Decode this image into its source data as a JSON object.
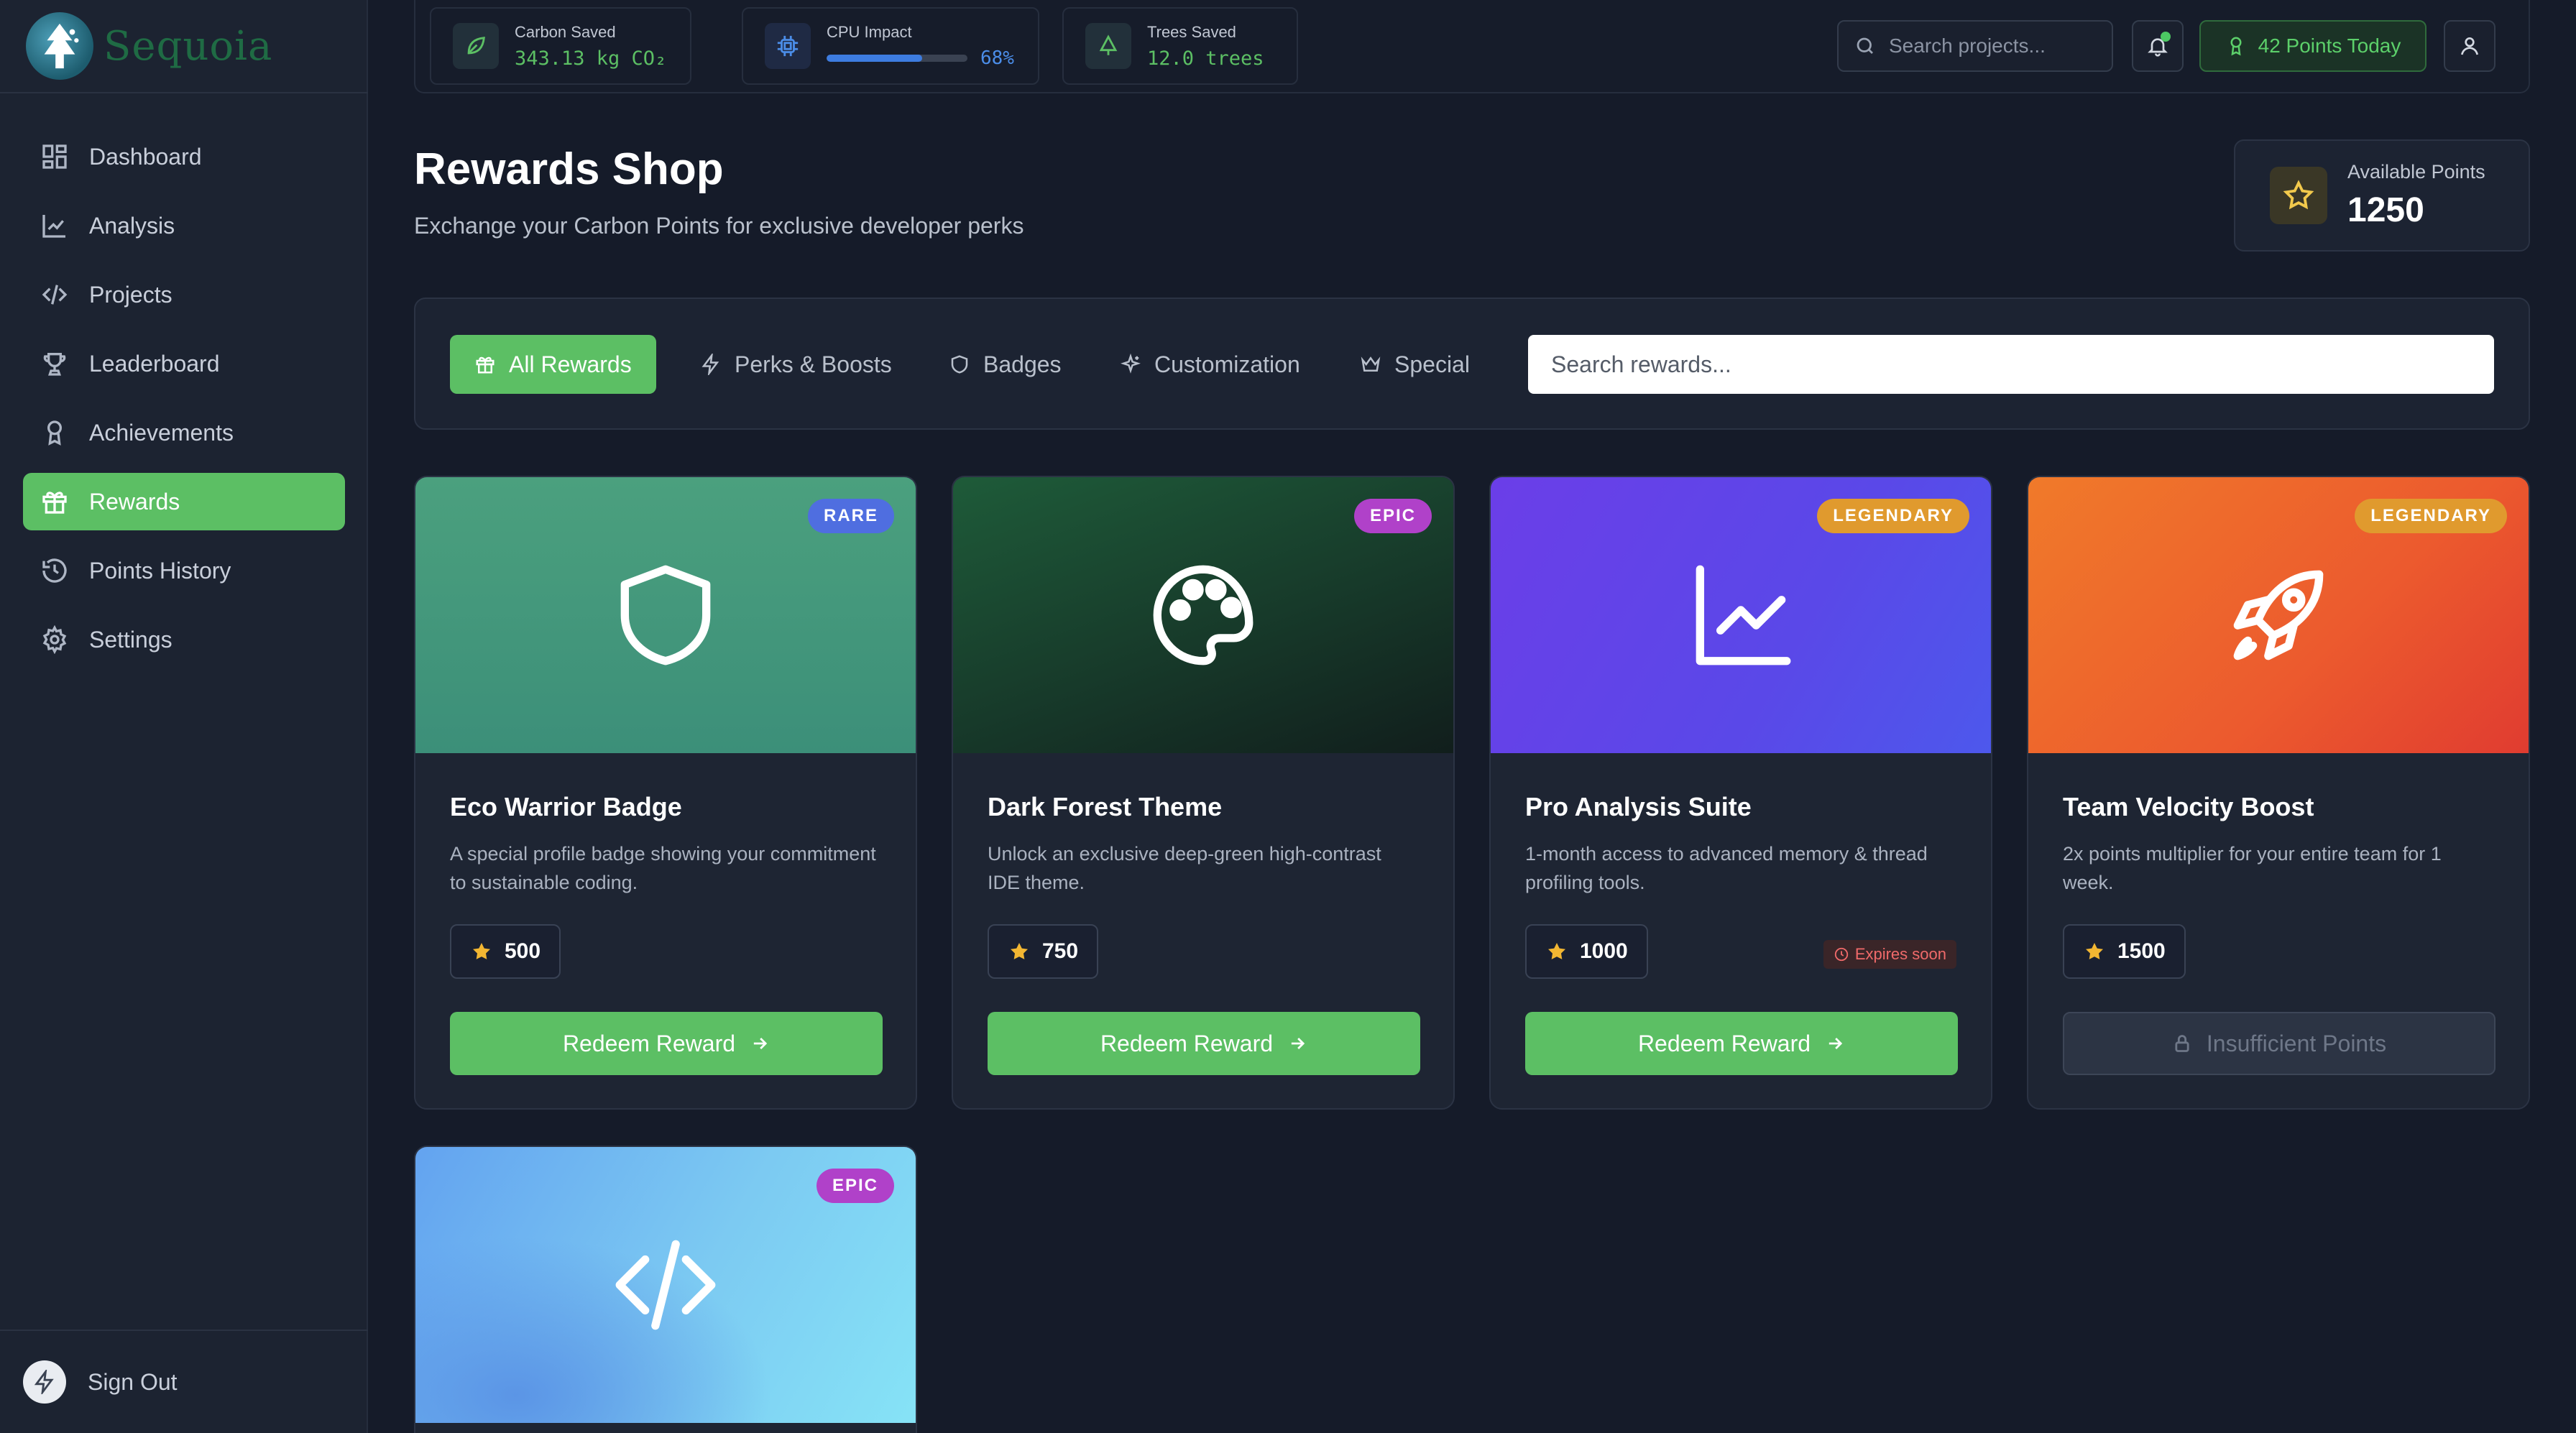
{
  "brand": {
    "name": "Sequoia"
  },
  "nav": {
    "items": [
      {
        "label": "Dashboard",
        "icon": "grid-icon"
      },
      {
        "label": "Analysis",
        "icon": "line-chart-icon"
      },
      {
        "label": "Projects",
        "icon": "code-icon"
      },
      {
        "label": "Leaderboard",
        "icon": "trophy-icon"
      },
      {
        "label": "Achievements",
        "icon": "award-icon"
      },
      {
        "label": "Rewards",
        "icon": "gift-icon",
        "active": true
      },
      {
        "label": "Points History",
        "icon": "history-icon"
      },
      {
        "label": "Settings",
        "icon": "gear-icon"
      }
    ],
    "sign_out": "Sign Out"
  },
  "topbar": {
    "carbon": {
      "label": "Carbon Saved",
      "value": "343.13 kg CO₂"
    },
    "cpu": {
      "label": "CPU Impact",
      "value": "68%",
      "percent": 68
    },
    "trees": {
      "label": "Trees Saved",
      "value": "12.0 trees"
    },
    "search_placeholder": "Search projects...",
    "points_today": "42 Points Today"
  },
  "header": {
    "title": "Rewards Shop",
    "subtitle": "Exchange your Carbon Points for exclusive developer perks",
    "available_label": "Available Points",
    "available_value": "1250"
  },
  "filters": {
    "tabs": [
      {
        "label": "All Rewards",
        "icon": "gift-icon",
        "active": true
      },
      {
        "label": "Perks & Boosts",
        "icon": "zap-icon"
      },
      {
        "label": "Badges",
        "icon": "shield-icon"
      },
      {
        "label": "Customization",
        "icon": "sparkles-icon"
      },
      {
        "label": "Special",
        "icon": "crown-icon"
      }
    ],
    "search_placeholder": "Search rewards..."
  },
  "rewards": [
    {
      "title": "Eco Warrior Badge",
      "rarity": "RARE",
      "description": "A special profile badge showing your commitment to sustainable coding.",
      "cost": "500",
      "button": "Redeem Reward",
      "icon": "shield-icon"
    },
    {
      "title": "Dark Forest Theme",
      "rarity": "EPIC",
      "description": "Unlock an exclusive deep-green high-contrast IDE theme.",
      "cost": "750",
      "button": "Redeem Reward",
      "icon": "palette-icon"
    },
    {
      "title": "Pro Analysis Suite",
      "rarity": "LEGENDARY",
      "description": "1-month access to advanced memory & thread profiling tools.",
      "cost": "1000",
      "button": "Redeem Reward",
      "badge": "Expires soon",
      "icon": "line-chart-icon"
    },
    {
      "title": "Team Velocity Boost",
      "rarity": "LEGENDARY",
      "description": "2x points multiplier for your entire team for 1 week.",
      "cost": "1500",
      "button": "Insufficient Points",
      "icon": "rocket-icon"
    },
    {
      "rarity": "EPIC",
      "icon": "code-icon"
    }
  ]
}
